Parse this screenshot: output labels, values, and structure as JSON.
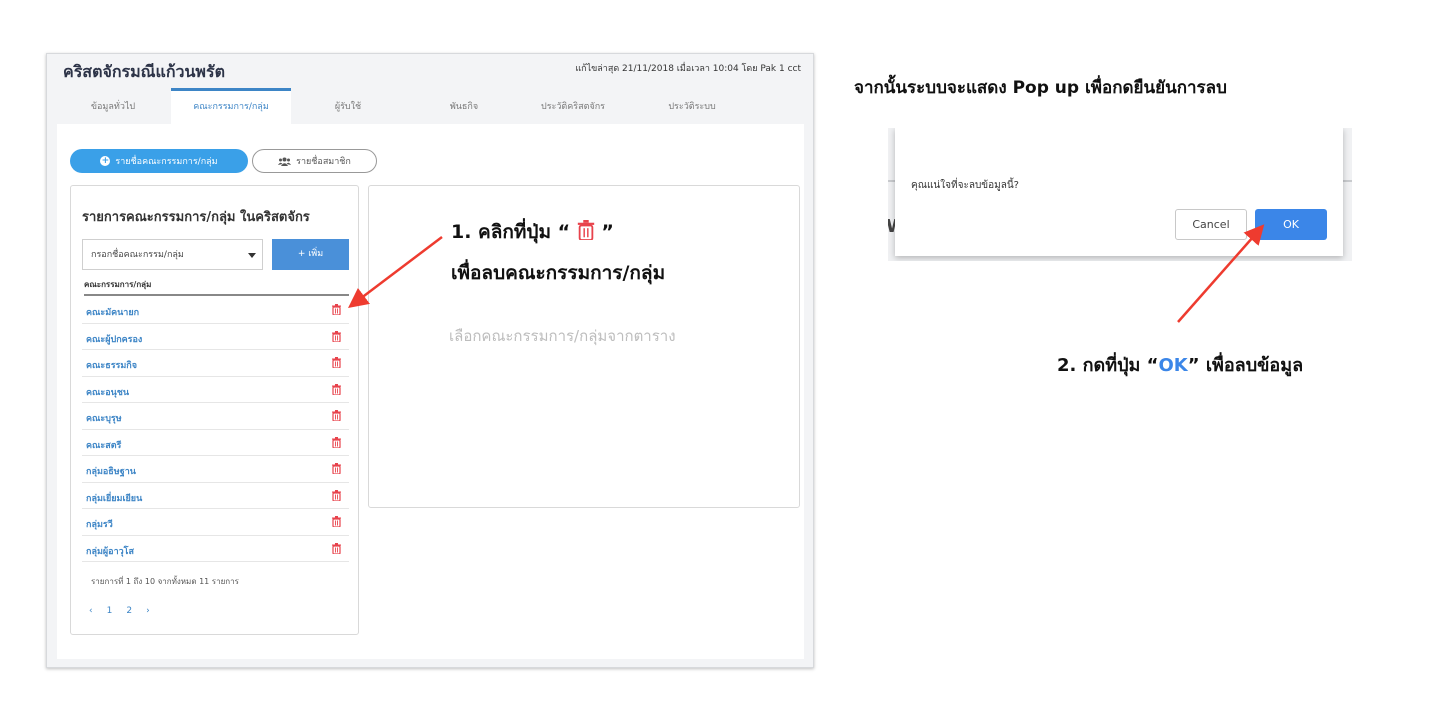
{
  "app": {
    "title": "คริสตจักรมณีแก้วนพรัต",
    "last_edit": "แก้ไขล่าสุด 21/11/2018 เมื่อเวลา 10:04 โดย Pak 1 cct"
  },
  "tabs": [
    {
      "label": "ข้อมูลทั่วไป"
    },
    {
      "label": "คณะกรรมการ/กลุ่ม"
    },
    {
      "label": "ผู้รับใช้"
    },
    {
      "label": "พันธกิจ"
    },
    {
      "label": "ประวัติคริสตจักร"
    },
    {
      "label": "ประวัติระบบ"
    }
  ],
  "buttons": {
    "committee_list": "รายชื่อคณะกรรมการ/กลุ่ม",
    "member_list": "รายชื่อสมาชิก",
    "add": "+ เพิ่ม"
  },
  "list": {
    "title": "รายการคณะกรรมการ/กลุ่ม ในคริสตจักร",
    "select_value": "กรอกชื่อคณะกรรม/กลุ่ม",
    "column_header": "คณะกรรมการ/กลุ่ม",
    "rows": [
      {
        "name": "คณะมัคนายก"
      },
      {
        "name": "คณะผู้ปกครอง"
      },
      {
        "name": "คณะธรรมกิจ"
      },
      {
        "name": "คณะอนุชน"
      },
      {
        "name": "คณะบุรุษ"
      },
      {
        "name": "คณะสตรี"
      },
      {
        "name": "กลุ่มอธิษฐาน"
      },
      {
        "name": "กลุ่มเยี่ยมเยียน"
      },
      {
        "name": "กลุ่มรวี"
      },
      {
        "name": "กลุ่มผู้อาวุโส"
      }
    ],
    "footer": "รายการที่ 1 ถึง 10 จากทั้งหมด 11 รายการ",
    "pagination": {
      "prev": "‹",
      "pages": [
        "1",
        "2"
      ],
      "next": "›"
    }
  },
  "detail": {
    "placeholder": "เลือกคณะกรรมการ/กลุ่มจากตาราง"
  },
  "annotations": {
    "step1_prefix": "1. คลิกที่ปุ่ม “",
    "step1_suffix": "”",
    "step1_line2": "เพื่อลบคณะกรรมการ/กลุ่ม",
    "right_heading": "จากนั้นระบบจะแสดง Pop up เพื่อกดยืนยันการลบ",
    "step2_prefix": "2. กดที่ปุ่ม “",
    "step2_ok": "OK",
    "step2_suffix": "” เพื่อลบข้อมูล"
  },
  "dialog": {
    "message": "คุณแน่ใจที่จะลบข้อมูลนี้?",
    "cancel_label": "Cancel",
    "ok_label": "OK",
    "background_letter": "W"
  },
  "colors": {
    "accent": "#3d85c6",
    "primary_button": "#3aa0e8",
    "ok_button": "#3b86e8",
    "delete_icon": "#e8434c",
    "arrow": "#ee3b2f"
  },
  "icons": [
    "plus-circle-icon",
    "users-icon",
    "trash-icon",
    "caret-down-icon"
  ]
}
